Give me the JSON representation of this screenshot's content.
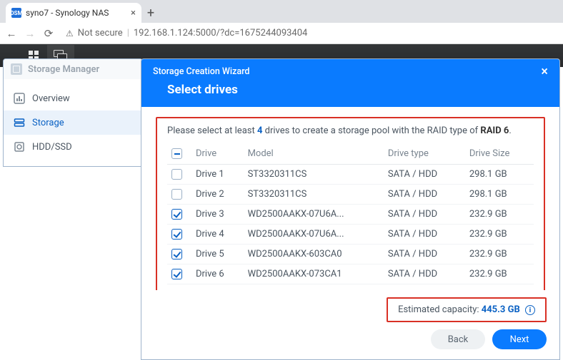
{
  "browser": {
    "tab_title": "syno7 - Synology NAS",
    "favicon_text": "DSM",
    "url_security": "Not secure",
    "url": "192.168.1.124:5000/?dc=1675244093404"
  },
  "storage_manager": {
    "title": "Storage Manager",
    "nav": {
      "overview": "Overview",
      "storage": "Storage",
      "hdd_ssd": "HDD/SSD"
    }
  },
  "wizard": {
    "title": "Storage Creation Wizard",
    "step_title": "Select drives",
    "prompt_pre": "Please select at least ",
    "prompt_count": "4",
    "prompt_mid": " drives to create a storage pool with the RAID type of ",
    "prompt_raid": "RAID 6",
    "prompt_post": ".",
    "columns": {
      "drive": "Drive",
      "model": "Model",
      "type": "Drive type",
      "size": "Drive Size"
    },
    "rows": [
      {
        "checked": false,
        "drive": "Drive 1",
        "model": "ST3320311CS",
        "type": "SATA / HDD",
        "size": "298.1 GB"
      },
      {
        "checked": false,
        "drive": "Drive 2",
        "model": "ST3320311CS",
        "type": "SATA / HDD",
        "size": "298.1 GB"
      },
      {
        "checked": true,
        "drive": "Drive 3",
        "model": "WD2500AAKX-07U6A...",
        "type": "SATA / HDD",
        "size": "232.9 GB"
      },
      {
        "checked": true,
        "drive": "Drive 4",
        "model": "WD2500AAKX-07U6A...",
        "type": "SATA / HDD",
        "size": "232.9 GB"
      },
      {
        "checked": true,
        "drive": "Drive 5",
        "model": "WD2500AAKX-603CA0",
        "type": "SATA / HDD",
        "size": "232.9 GB"
      },
      {
        "checked": true,
        "drive": "Drive 6",
        "model": "WD2500AAKX-073CA1",
        "type": "SATA / HDD",
        "size": "232.9 GB"
      }
    ],
    "estimated_label": "Estimated capacity: ",
    "estimated_value": "445.3 GB",
    "back": "Back",
    "next": "Next"
  }
}
